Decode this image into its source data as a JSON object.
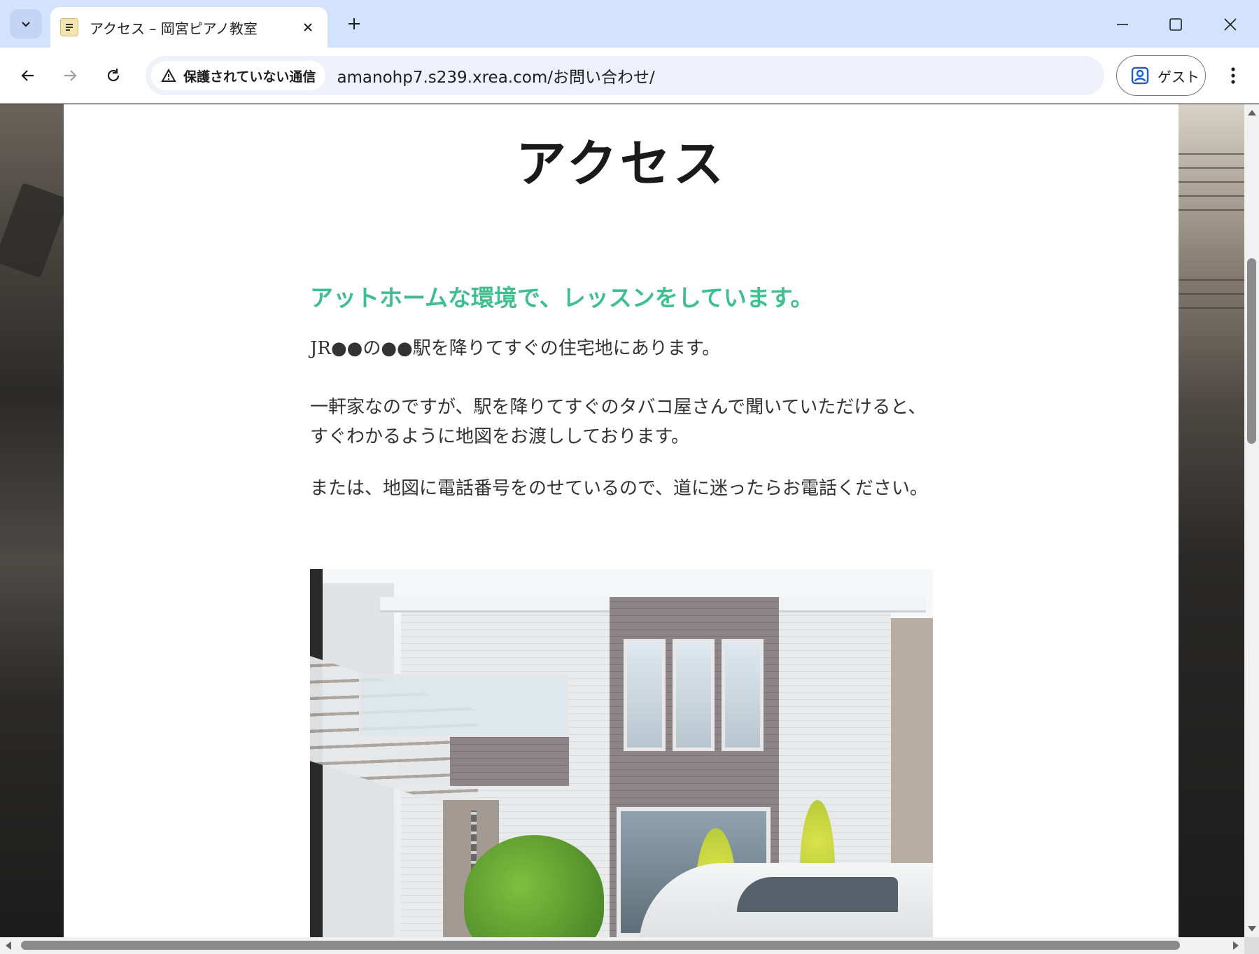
{
  "browser": {
    "tab_title": "アクセス – 岡宮ピアノ教室",
    "security_label": "保護されていない通信",
    "url": "amanohp7.s239.xrea.com/お問い合わせ/",
    "profile_label": "ゲスト",
    "icons": {
      "tab_search": "chevron-down-icon",
      "favicon": "site-favicon-icon",
      "tab_close": "close-icon",
      "new_tab": "plus-icon",
      "minimize": "minimize-icon",
      "maximize": "maximize-icon",
      "close_window": "close-icon",
      "back": "arrow-left-icon",
      "forward": "arrow-right-icon",
      "reload": "reload-icon",
      "warning": "warning-icon",
      "profile": "person-icon",
      "menu": "more-vertical-icon"
    }
  },
  "page": {
    "title": "アクセス",
    "heading": "アットホームな環境で、レッスンをしています。",
    "paragraphs": [
      "JR●●の●●駅を降りてすぐの住宅地にあります。",
      "一軒家なのですが、駅を降りてすぐのタバコ屋さんで聞いていただけると、すぐわかるように地図をお渡ししております。",
      "または、地図に電話番号をのせているので、道に迷ったらお電話ください。"
    ],
    "heading_color": "#3fbf8f"
  }
}
